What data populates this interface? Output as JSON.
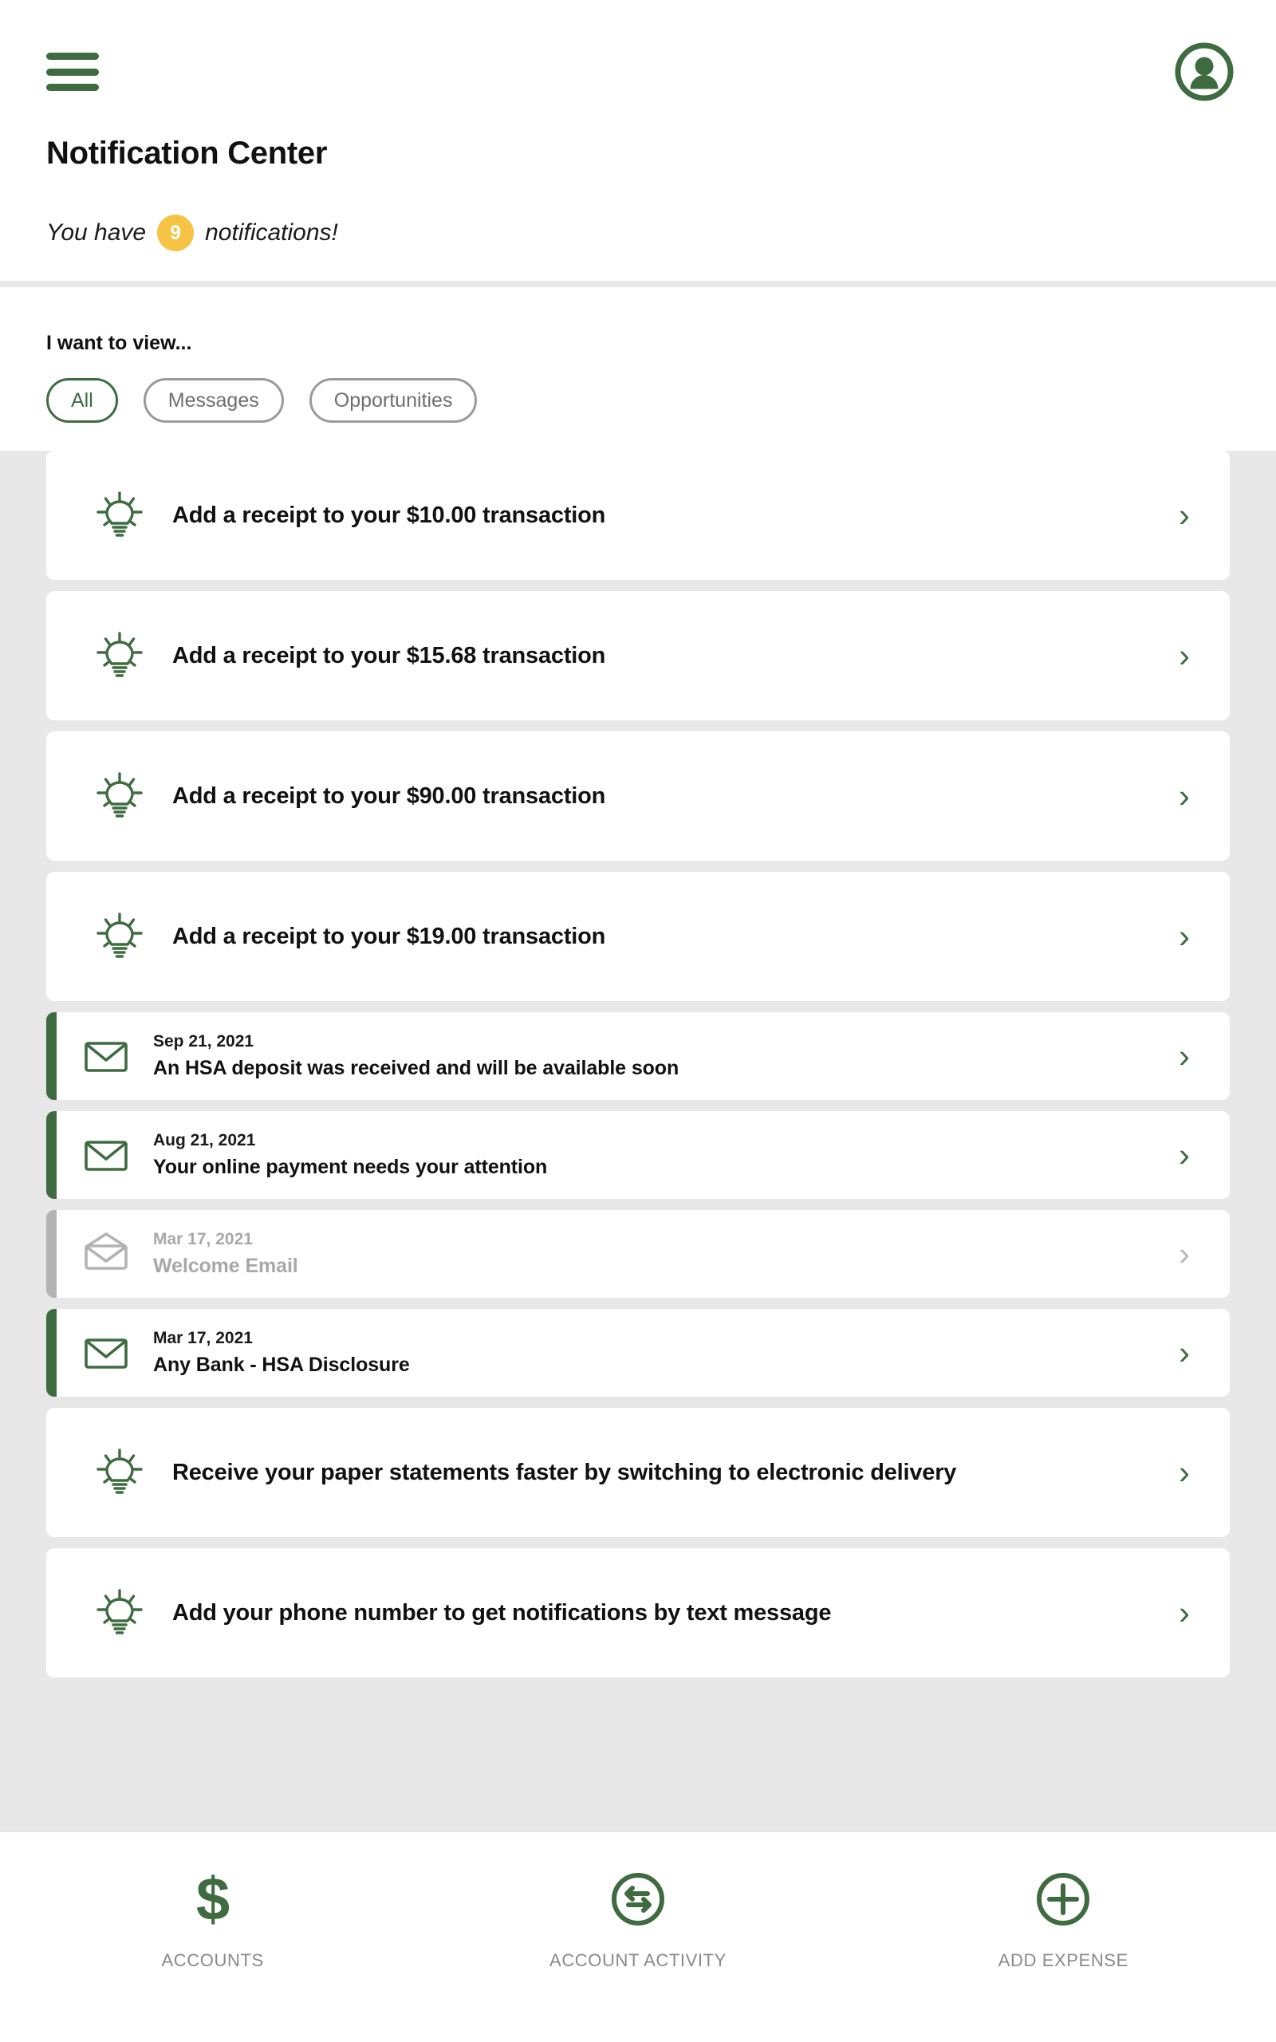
{
  "header": {
    "menu_icon": "hamburger-menu-icon",
    "avatar_icon": "user-avatar-icon",
    "title": "Notification Center",
    "subtitle_prefix": "You have",
    "notification_count": "9",
    "subtitle_suffix": "notifications!"
  },
  "filter": {
    "label": "I want to view...",
    "chips": [
      {
        "label": "All",
        "active": true
      },
      {
        "label": "Messages",
        "active": false
      },
      {
        "label": "Opportunities",
        "active": false
      }
    ]
  },
  "notifications": [
    {
      "kind": "opportunity",
      "icon": "lightbulb-icon",
      "title": "Add a receipt to your $10.00 transaction",
      "chevron": "›"
    },
    {
      "kind": "opportunity",
      "icon": "lightbulb-icon",
      "title": "Add a receipt to your $15.68 transaction",
      "chevron": "›"
    },
    {
      "kind": "opportunity",
      "icon": "lightbulb-icon",
      "title": "Add a receipt to your $90.00 transaction",
      "chevron": "›"
    },
    {
      "kind": "opportunity",
      "icon": "lightbulb-icon",
      "title": "Add a receipt to your $19.00 transaction",
      "chevron": "›"
    },
    {
      "kind": "message",
      "icon": "envelope-closed-icon",
      "read": false,
      "date": "Sep 21, 2021",
      "subject": "An HSA deposit was received and will be available soon",
      "chevron": "›"
    },
    {
      "kind": "message",
      "icon": "envelope-closed-icon",
      "read": false,
      "date": "Aug 21, 2021",
      "subject": "Your online payment needs your attention",
      "chevron": "›"
    },
    {
      "kind": "message",
      "icon": "envelope-open-icon",
      "read": true,
      "date": "Mar 17, 2021",
      "subject": "Welcome Email",
      "chevron": "›"
    },
    {
      "kind": "message",
      "icon": "envelope-closed-icon",
      "read": false,
      "date": "Mar 17, 2021",
      "subject": "Any Bank - HSA Disclosure",
      "chevron": "›"
    },
    {
      "kind": "opportunity",
      "icon": "lightbulb-icon",
      "title": "Receive your paper statements faster by switching to electronic delivery",
      "chevron": "›"
    },
    {
      "kind": "opportunity",
      "icon": "lightbulb-icon",
      "title": "Add your phone number to get notifications by text message",
      "chevron": "›"
    }
  ],
  "bottom_nav": [
    {
      "icon": "dollar-sign-icon",
      "label": "ACCOUNTS"
    },
    {
      "icon": "transfer-arrows-circle-icon",
      "label": "ACCOUNT ACTIVITY"
    },
    {
      "icon": "plus-circle-icon",
      "label": "ADD EXPENSE"
    }
  ],
  "colors": {
    "brand_green": "#3f6b41",
    "badge_yellow": "#f6c344",
    "page_background": "#e8e8e8",
    "card_background": "#ffffff",
    "muted_gray": "#a8a8a8"
  }
}
